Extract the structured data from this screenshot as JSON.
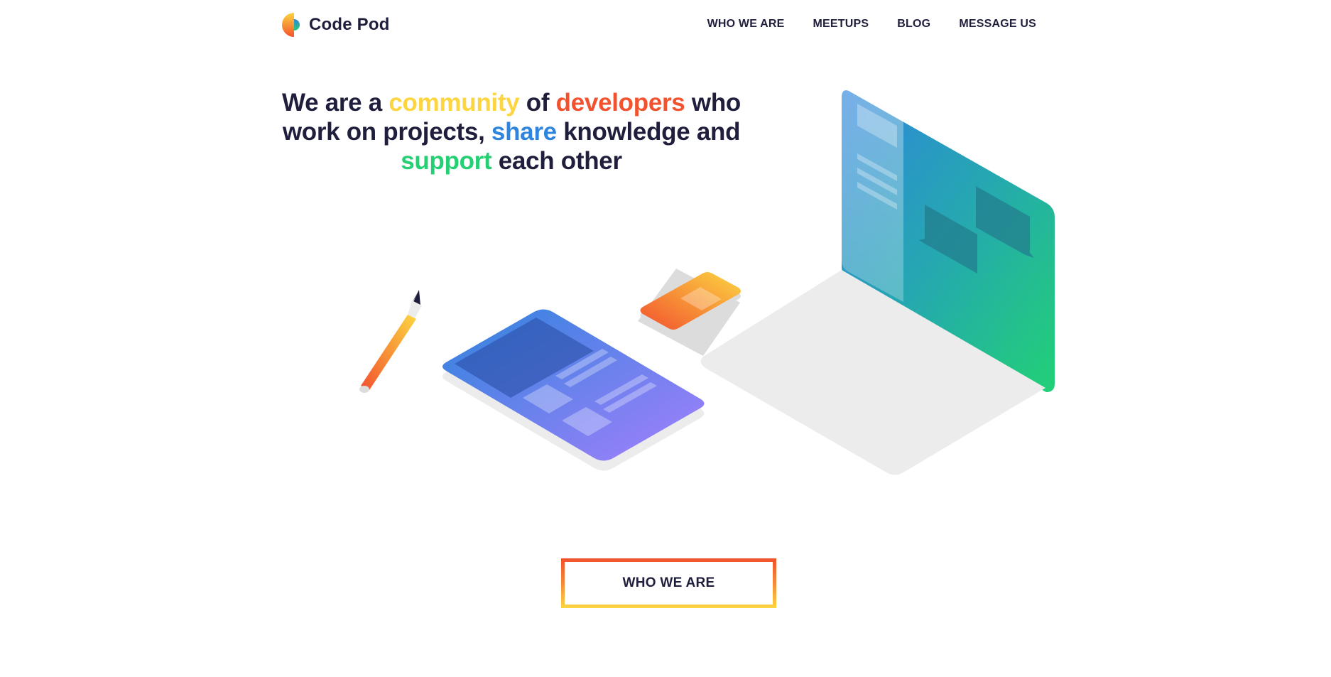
{
  "brand": {
    "name": "Code Pod",
    "logo_icon": "code-pod-logo-icon"
  },
  "nav": {
    "items": [
      {
        "label": "WHO WE ARE"
      },
      {
        "label": "MEETUPS"
      },
      {
        "label": "BLOG"
      },
      {
        "label": "MESSAGE US"
      }
    ]
  },
  "hero": {
    "headline": {
      "w1": "We are a ",
      "w_community": "community",
      "w2": " of ",
      "w_developers": "developers",
      "w3": " who work on projects, ",
      "w_share": "share",
      "w4": " knowledge and ",
      "w_support": "support",
      "w5": " each other"
    },
    "illustration_icons": [
      "pencil-icon",
      "tablet-icon",
      "phone-icon",
      "laptop-icon"
    ]
  },
  "cta": {
    "label": "WHO WE ARE"
  },
  "colors": {
    "text": "#1f1f3d",
    "yellow": "#fcd541",
    "orange": "#f2522e",
    "blue": "#2f84dd",
    "green": "#25cf73"
  }
}
